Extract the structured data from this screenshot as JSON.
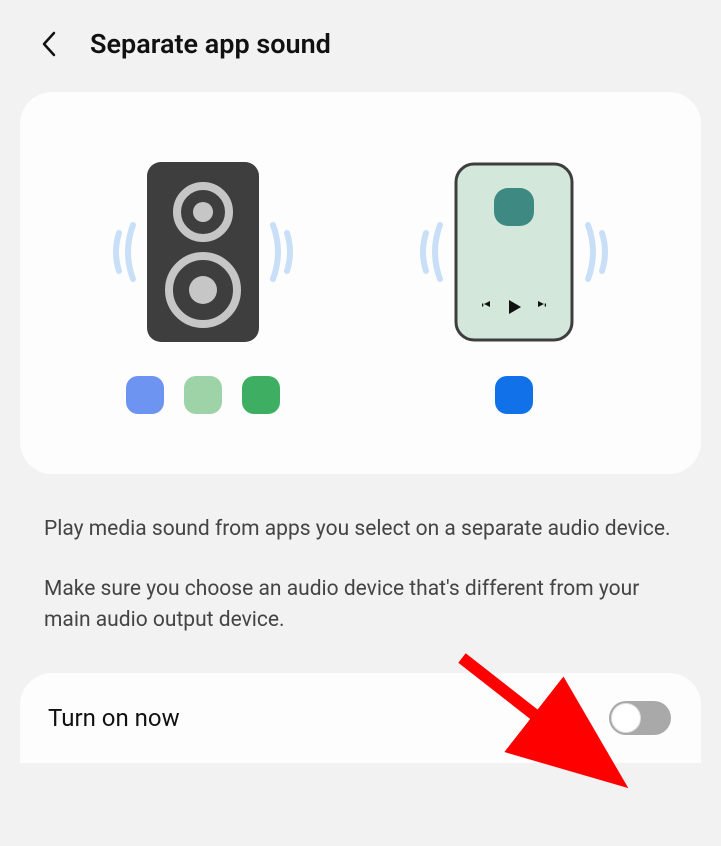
{
  "header": {
    "title": "Separate app sound"
  },
  "description": {
    "line1": "Play media sound from apps you select on a separate audio device.",
    "line2": "Make sure you choose an audio device that's different from your main audio output device."
  },
  "toggle": {
    "label": "Turn on now",
    "state": "off"
  },
  "colors": {
    "card_bg": "#fdfdfd",
    "page_bg": "#f2f2f2",
    "wave": "#c9dff7",
    "speaker_body": "#3e3e3e",
    "speaker_ring": "#c6c6c6",
    "phone_body": "#d3e7db",
    "phone_border": "#3e3e3e",
    "phone_camera": "#3e8a82",
    "dot_blue": "#6e94f2",
    "dot_mint": "#9ed3a8",
    "dot_green": "#3eaf62",
    "dot_blue2": "#1171e8",
    "toggle_off_track": "#a9a9a9",
    "arrow": "#ff0000"
  }
}
